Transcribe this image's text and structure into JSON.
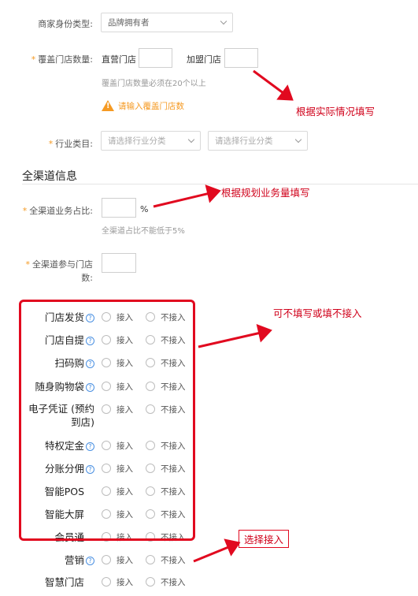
{
  "merchant": {
    "identity_label": "商家身份类型:",
    "identity_value": "品牌拥有者",
    "stores_label": "覆盖门店数量:",
    "direct_label": "直营门店",
    "franchise_label": "加盟门店",
    "stores_hint": "覆盖门店数量必须在20个以上",
    "stores_warning": "请输入覆盖门店数",
    "industry_label": "行业类目:",
    "industry_placeholder_1": "请选择行业分类",
    "industry_placeholder_2": "请选择行业分类"
  },
  "omni": {
    "section_title": "全渠道信息",
    "ratio_label": "全渠道业务占比:",
    "ratio_unit": "%",
    "ratio_hint": "全渠道占比不能低于5%",
    "stores_label_line1": "全渠道参与门店",
    "stores_label_line2": "数:"
  },
  "features": {
    "option_connect": "接入",
    "option_not_connect": "不接入",
    "items": [
      {
        "label": "门店发货",
        "help": true
      },
      {
        "label": "门店自提",
        "help": true
      },
      {
        "label": "扫码购",
        "help": true
      },
      {
        "label": "随身购物袋",
        "help": true
      },
      {
        "label_line1": "电子凭证 (预约",
        "label_line2": "到店)",
        "help": true
      },
      {
        "label": "特权定金",
        "help": true
      },
      {
        "label": "分账分佣",
        "help": true
      },
      {
        "label": "智能POS",
        "help": false
      },
      {
        "label": "智能大屏",
        "help": false
      },
      {
        "label": "会员通",
        "help": false
      },
      {
        "label": "营销",
        "help": true
      },
      {
        "label": "智慧门店",
        "help": false
      }
    ]
  },
  "annotations": {
    "fill_actual": "根据实际情况填写",
    "fill_plan": "根据规划业务量填写",
    "optional": "可不填写或填不接入",
    "choose_connect": "选择接入",
    "accent_color": "#e1091f"
  }
}
